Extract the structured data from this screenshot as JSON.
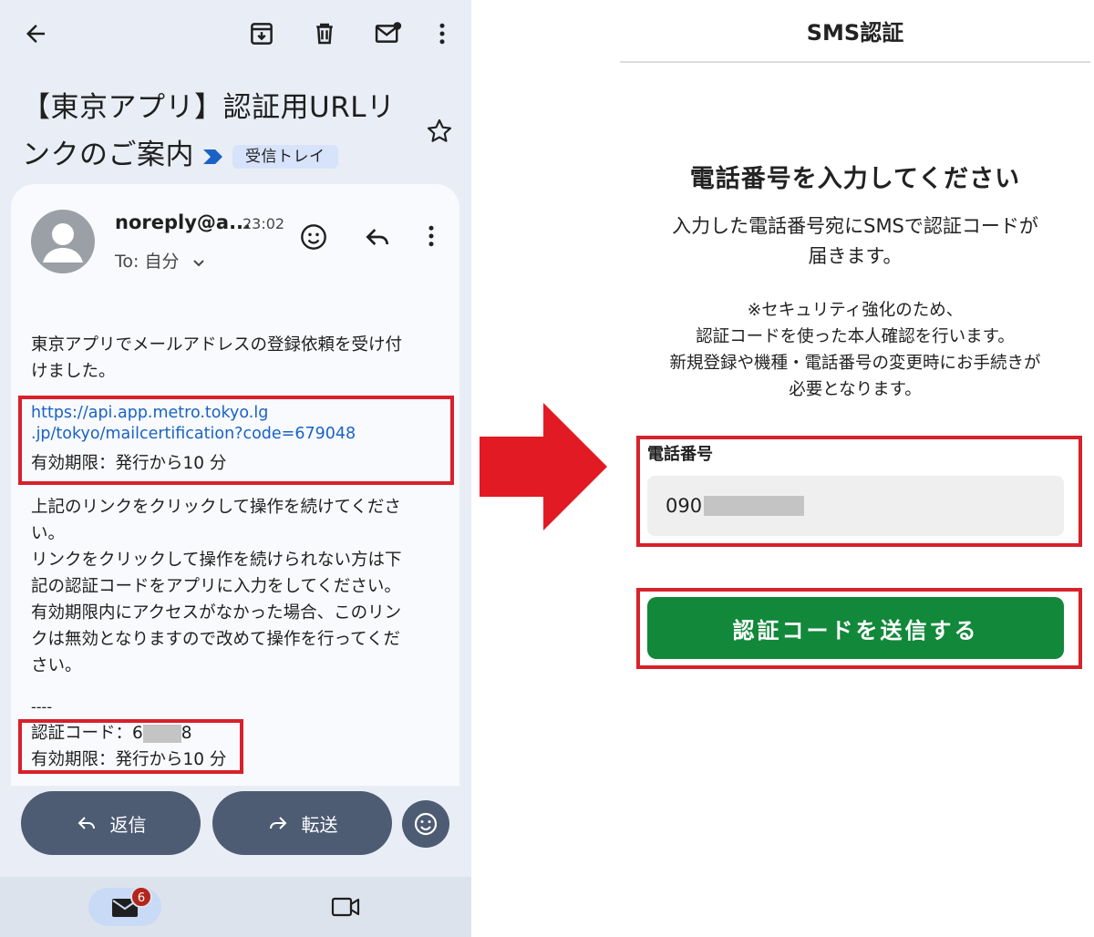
{
  "mail": {
    "subject": "【東京アプリ】認証用URLリンクのご案内",
    "label": "受信トレイ",
    "sender": "noreply@a...",
    "time": "23:02",
    "recipient": "To: 自分",
    "body_intro_1": "東京アプリでメールアドレスの登録依頼を受け付",
    "body_intro_2": "けました。",
    "link_text": "https://api.app.metro.tokyo.lg\n.jp/tokyo/mailcertification?code=679048",
    "validity": "有効期限：発行から10 分",
    "instructions": [
      "上記のリンクをクリックして操作を続けてくださ",
      "い。",
      "リンクをクリックして操作を続けられない方は下",
      "記の認証コードをアプリに入力をしてください。",
      "有効期限内にアクセスがなかった場合、このリン",
      "クは無効となりますので改めて操作を行ってくだ",
      "さい。"
    ],
    "separator": "----",
    "code_label": "認証コード：",
    "code_prefix": "6",
    "code_suffix": "8",
    "validity_2": "有効期限：発行から10 分",
    "reply_label": "返信",
    "forward_label": "転送",
    "unread_badge": "6"
  },
  "sms": {
    "title": "SMS認証",
    "heading": "電話番号を入力してください",
    "desc_1": "入力した電話番号宛にSMSで認証コードが",
    "desc_2": "届きます。",
    "note": [
      "※セキュリティ強化のため、",
      "認証コードを使った本人確認を行います。",
      "新規登録や機種・電話番号の変更時にお手続きが",
      "必要となります。"
    ],
    "phone_label": "電話番号",
    "phone_prefix": "090",
    "send_button": "認証コードを送信する"
  },
  "colors": {
    "highlight_box": "#d7212b",
    "send_button": "#12883a",
    "arrow": "#e21a24",
    "link": "#1a62c5"
  }
}
